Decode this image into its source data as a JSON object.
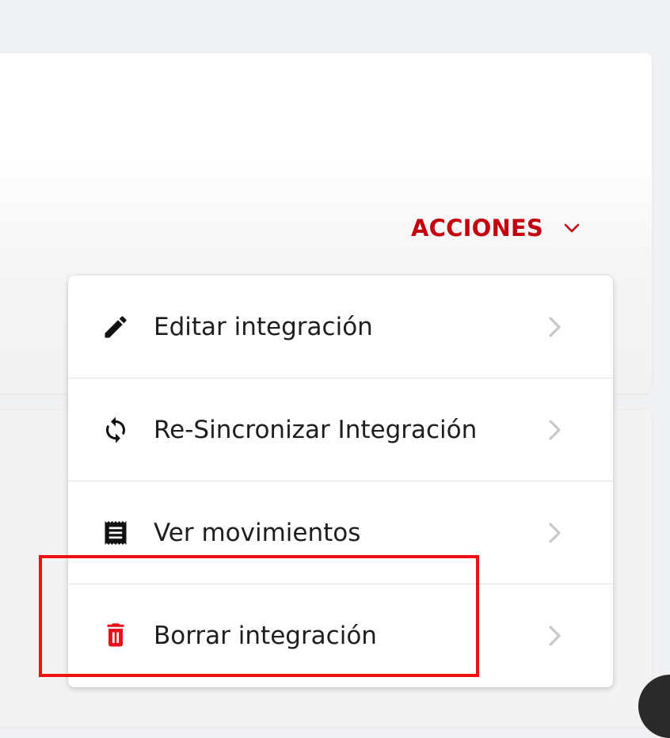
{
  "actions": {
    "label": "ACCIONES",
    "chevron_icon": "chevron-down-icon",
    "accent_color": "#c4000e"
  },
  "menu": {
    "items": [
      {
        "label": "Editar integración",
        "icon": "pencil-icon",
        "icon_color": "#111111"
      },
      {
        "label": "Re-Sincronizar Integración",
        "icon": "sync-icon",
        "icon_color": "#111111"
      },
      {
        "label": "Ver movimientos",
        "icon": "receipt-icon",
        "icon_color": "#111111"
      },
      {
        "label": "Borrar integración",
        "icon": "trash-icon",
        "icon_color": "#e8101a"
      }
    ],
    "chevron_icon": "chevron-right-icon",
    "chevron_color": "#c8c8c8"
  },
  "annotation": {
    "highlight_color": "#f20f0f"
  }
}
